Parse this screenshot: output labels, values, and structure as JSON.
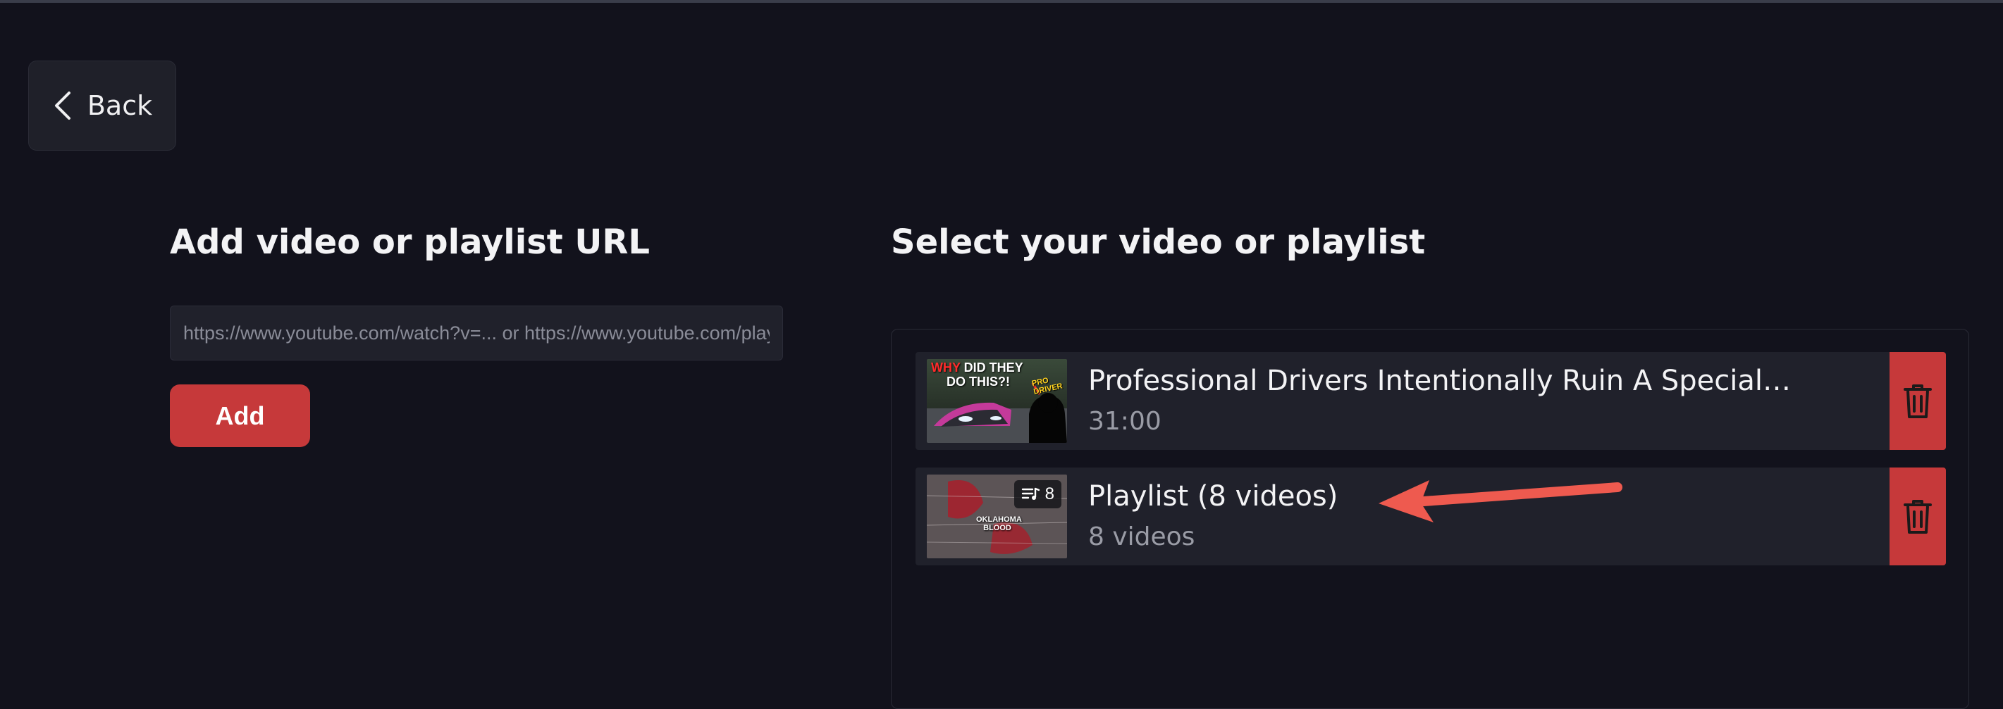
{
  "back": {
    "label": "Back"
  },
  "add_section": {
    "title": "Add video or playlist URL",
    "url_placeholder": "https://www.youtube.com/watch?v=... or https://www.youtube.com/playlist?list=...",
    "url_value": "",
    "add_label": "Add"
  },
  "select_section": {
    "title": "Select your video or playlist",
    "items": [
      {
        "type": "video",
        "title": "Professional Drivers Intentionally Ruin A Special ...",
        "subtitle": "31:00",
        "thumbnail": {
          "caption_red": "WHY",
          "caption_white": " DID THEY",
          "caption_line2": "DO THIS?!",
          "tag": "PRO DRIVER"
        }
      },
      {
        "type": "playlist",
        "title": "Playlist (8 videos)",
        "subtitle": "8 videos",
        "thumbnail": {
          "badge_count": "8",
          "caption": "OKLAHOMA BLOOD"
        }
      }
    ]
  },
  "icons": {
    "back": "chevron-left-icon",
    "delete": "trash-icon",
    "playlist": "playlist-icon"
  },
  "colors": {
    "background": "#12121c",
    "card": "#20212b",
    "accent_red": "#c6393a",
    "annotation_arrow": "#ee5a4f",
    "muted_text": "#9a9ca6"
  }
}
